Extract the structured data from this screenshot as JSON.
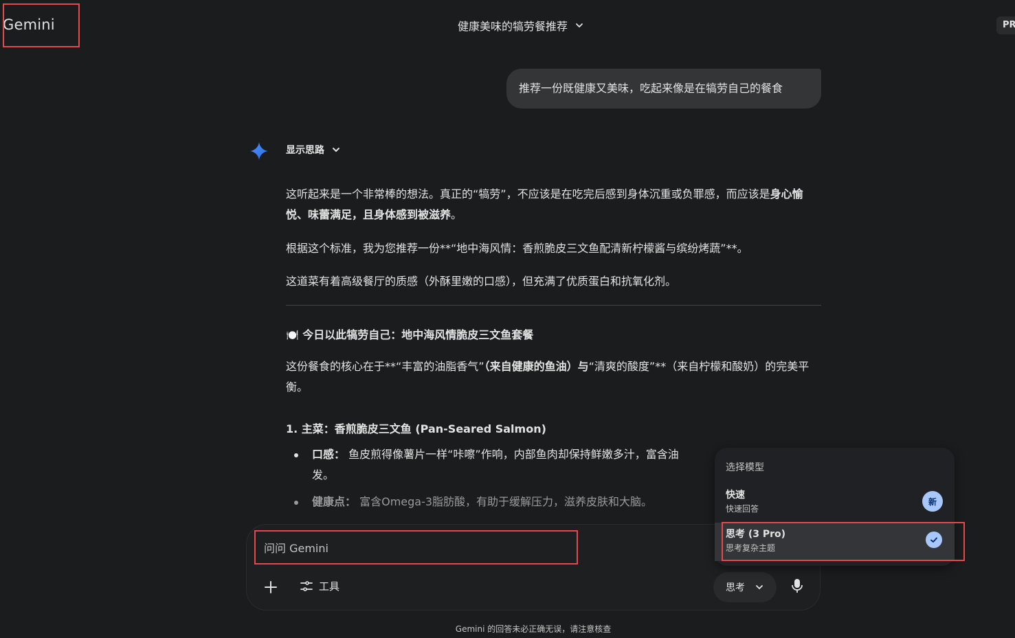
{
  "app": {
    "logo": "Gemini",
    "pro_badge": "PR"
  },
  "header": {
    "chat_title": "健康美味的犒劳餐推荐"
  },
  "user_message": "推荐一份既健康又美味，吃起来像是在犒劳自己的餐食",
  "response": {
    "show_thoughts": "显示思路",
    "p1_a": "这听起来是一个非常棒的想法。真正的“犒劳”，不应该是在吃完后感到身体沉重或负罪感，而应该是",
    "p1_b": "身心愉悦、味蕾满足，且身体感到被滋养",
    "p1_c": "。",
    "p2": "根据这个标准，我为您推荐一份**“地中海风情：香煎脆皮三文鱼配清新柠檬酱与缤纷烤蔬”**。",
    "p3": "这道菜有着高级餐厅的质感（外酥里嫩的口感），但充满了优质蛋白和抗氧化剂。",
    "section_emoji": "🍽️",
    "section_title": "今日以此犒劳自己：地中海风情脆皮三文鱼套餐",
    "p4_a": "这份餐食的核心在于**“丰富的油脂香气”",
    "p4_b": "（来自健康的鱼油）与",
    "p4_c": "“清爽的酸度”**（来自柠檬和酸奶）的完美平衡。",
    "item1_title": "1. 主菜：香煎脆皮三文鱼 (Pan-Seared Salmon)",
    "bullet1_label": "口感：",
    "bullet1_text": "鱼皮煎得像薯片一样“咔嚓”作响，内部鱼肉却保持鲜嫩多汁，富含油",
    "bullet1_cont": "发。",
    "bullet2_label": "健康点：",
    "bullet2_text": "富含Omega-3脂肪酸，有助于缓解压力，滋养皮肤和大脑。"
  },
  "composer": {
    "placeholder": "问问 Gemini",
    "tools_label": "工具",
    "mode_label": "思考"
  },
  "model_menu": {
    "title": "选择模型",
    "items": [
      {
        "title": "快速",
        "subtitle": "快速回答",
        "badge": "新"
      },
      {
        "title": "思考 (3 Pro)",
        "subtitle": "思考复杂主题",
        "selected": true
      }
    ]
  },
  "footer": {
    "disclaimer": "Gemini 的回答未必正确无误，请注意核查"
  },
  "colors": {
    "background": "#1b1c1d",
    "accent": "#a8c7fa",
    "highlight": "#e5484d"
  }
}
